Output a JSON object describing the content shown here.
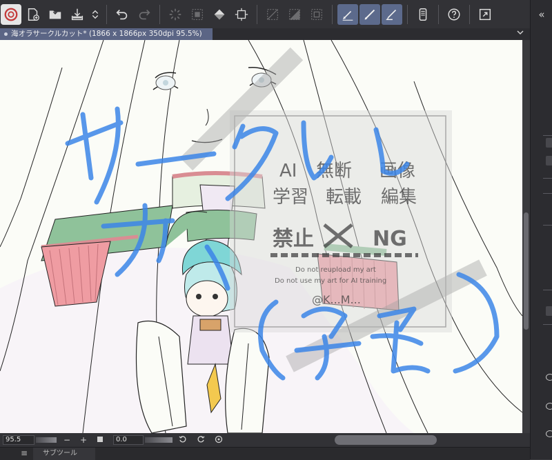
{
  "toolbar": {
    "buttons": [
      {
        "icon": "app-logo-icon"
      },
      {
        "icon": "new-canvas-icon"
      },
      {
        "icon": "open-folder-icon"
      },
      {
        "icon": "save-icon"
      },
      {
        "icon": "up-down-arrows-icon"
      },
      {
        "icon": "undo-icon"
      },
      {
        "icon": "redo-icon"
      },
      {
        "icon": "loading-spinner-icon"
      },
      {
        "icon": "clear-selection-icon"
      },
      {
        "icon": "fill-icon"
      },
      {
        "icon": "transform-icon"
      },
      {
        "icon": "invert-selection-icon"
      },
      {
        "icon": "selection-layer-icon"
      },
      {
        "icon": "crop-selection-icon"
      },
      {
        "icon": "pen-pressure-icon"
      },
      {
        "icon": "pencil-brush-icon"
      },
      {
        "icon": "eraser-pen-icon"
      },
      {
        "icon": "smartphone-icon"
      },
      {
        "icon": "help-icon"
      },
      {
        "icon": "fullscreen-icon"
      }
    ]
  },
  "document_tab": {
    "title": "海オラサークルカット* (1866 x 1866px 350dpi 95.5%)"
  },
  "statusbar": {
    "zoom": "95.5",
    "minus": "−",
    "plus": "+",
    "rotation": "0.0"
  },
  "bottom_panel": {
    "menu_icon": "≡",
    "subtool_label": "サブツール"
  },
  "right_strip": {
    "collapse": "«"
  },
  "canvas": {
    "annotation_text": "サークルカット(予定)",
    "watermark": {
      "line1": [
        "AI",
        "無断",
        "画像"
      ],
      "line2": [
        "学習",
        "転載",
        "編集"
      ],
      "ban": "禁止",
      "ng": "NG",
      "note1": "Do not reupload my art",
      "note2": "Do not use my art for AI training",
      "handle": "@K...M..."
    }
  }
}
